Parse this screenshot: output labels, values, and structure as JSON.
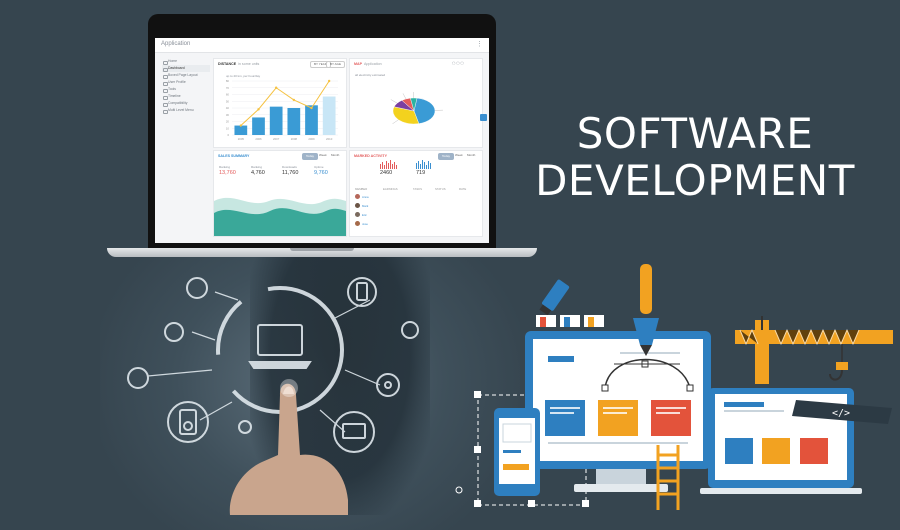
{
  "headline": {
    "line1": "SOFTWARE",
    "line2": "DEVELOPMENT"
  },
  "app": {
    "title": "Application",
    "nav": [
      "Home",
      "Dashboard",
      "Boxed Page Layout",
      "User Profile",
      "Tools",
      "Timeline",
      "Compatibility",
      "Multi Level Menu"
    ],
    "active_nav": 1,
    "distance_card": {
      "title": "DISTANCE",
      "subtitle": "in some units",
      "pill_left": "BY YEAR",
      "pill_right": "BY AGE",
      "note": "up to 20 km, per hour/day"
    },
    "map_card": {
      "title": "MAP",
      "subtitle": "Application",
      "note": "all electricity estimated"
    },
    "sales_card": {
      "title": "SALES SUMMARY",
      "tabs": [
        "Today",
        "Week",
        "Month"
      ],
      "stats": [
        {
          "label": "Ranking",
          "value": "13,760",
          "color": "#e35b5b"
        },
        {
          "label": "Ranking",
          "value": "4,760",
          "color": "#333333"
        },
        {
          "label": "Downloads",
          "value": "11,760",
          "color": "#333333"
        },
        {
          "label": "Uptime",
          "value": "9,760",
          "color": "#3a8fd0"
        }
      ]
    },
    "activity_card": {
      "title": "MARKED ACTIVITY",
      "tabs": [
        "Today",
        "Week",
        "Month"
      ],
      "counts": [
        {
          "value": "2460",
          "color": "#333333"
        },
        {
          "value": "719",
          "color": "#333333"
        }
      ],
      "columns": [
        "MEMBER",
        "EARNINGS",
        "TASKS",
        "STATUS",
        "RATE"
      ],
      "rows": [
        {
          "name": "Anna",
          "avatar": "#b5675a"
        },
        {
          "name": "Mark",
          "avatar": "#6b5546"
        },
        {
          "name": "Eric",
          "avatar": "#7a6a5e"
        },
        {
          "name": "Jose",
          "avatar": "#a56a4a"
        }
      ]
    }
  },
  "chart_data": {
    "type": "bar",
    "title": "",
    "categories": [
      "2005",
      "2006",
      "2007",
      "2008",
      "2009",
      "2010"
    ],
    "series": [
      {
        "values": [
          14,
          26,
          42,
          40,
          44,
          57
        ],
        "color": "#3a9bd5"
      },
      {
        "values": [
          14,
          38,
          70,
          52,
          40,
          96
        ],
        "type": "line",
        "color": "#f5c242"
      }
    ],
    "ylim": [
      0,
      80
    ],
    "y_ticks": [
      "0",
      "10",
      "20",
      "30",
      "40",
      "50",
      "60",
      "70",
      "80"
    ]
  },
  "pie_data": {
    "type": "pie",
    "slices": [
      {
        "value": 44,
        "color": "#3a9bd5"
      },
      {
        "value": 34,
        "color": "#f3d21e"
      },
      {
        "value": 10,
        "color": "#7b3fa0"
      },
      {
        "value": 7,
        "color": "#e35b5b"
      },
      {
        "value": 5,
        "color": "#2bb3a3"
      }
    ]
  },
  "colors": {
    "background": "#36454f",
    "accent_blue": "#2e7fc0",
    "accent_orange": "#f2a221",
    "accent_yellow": "#f5c242",
    "accent_red": "#e3533b",
    "icon_line": "#dfe7ec"
  },
  "icons": [
    "laptop-icon",
    "speaker-icon",
    "camera-icon",
    "code-icon",
    "pen-nib-icon",
    "crane-icon",
    "ladder-icon",
    "marker-icon"
  ]
}
